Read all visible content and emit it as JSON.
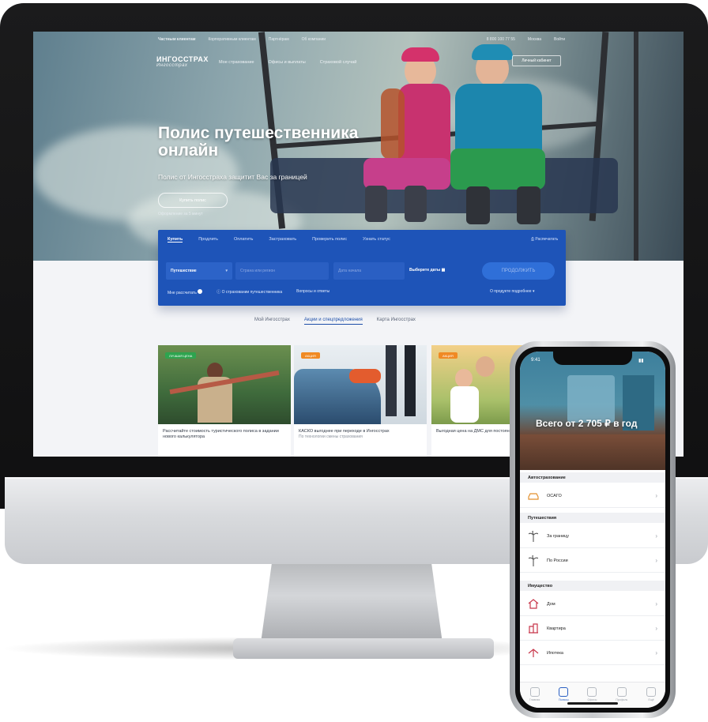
{
  "site": {
    "topnav": [
      "Частным клиентам",
      "Корпоративным клиентам",
      "Партнёрам",
      "Об компании"
    ],
    "topnav_right": [
      "8 800 100 77 55",
      "Москва",
      "Войти"
    ],
    "logo_text": "ИНГОССТРАХ",
    "logo_sub": "Ингосстрах",
    "mainnav": [
      "Мое страхование",
      "Офисы и выплаты",
      "Страховой случай"
    ],
    "login_label": "Личный кабинет",
    "hero": {
      "title": "Полис путешественника онлайн",
      "subtitle": "Полис от Ингосстраха защитит Вас за границей",
      "button": "Купить полис",
      "note": "Оформление за 5 минут"
    },
    "calc": {
      "tabs": [
        "Купить",
        "Продлить",
        "Оплатить",
        "Застраховать",
        "Проверить полис",
        "Узнать статус"
      ],
      "print_label": "Распечатать",
      "type_value": "Путешествие",
      "country_placeholder": "Страна или регион",
      "date_placeholder": "Дата начала",
      "dates_label": "Выберите даты",
      "submit_label": "ПРОДОЛЖИТЬ",
      "options": [
        "Мне рассчитать",
        "О страховании путешественника",
        "Вопросы и ответы"
      ],
      "more_label": "О продукте подробнее"
    },
    "page_tabs": [
      "Мой Ингосстрах",
      "Акции и спецпредложения",
      "Карта Ингосстрах"
    ],
    "cards": [
      {
        "tag": "ЛУЧШАЯ ЦЕНА",
        "text": "Рассчитайте стоимость туристического полиса в задании нового калькулятора"
      },
      {
        "tag": "АКЦИЯ",
        "text": "КАСКО выгоднее при переходе в Ингосстрах",
        "note": "По технологии смены страхования"
      },
      {
        "tag": "АКЦИЯ",
        "text": "Выгодная цена на ДМС для постоянных клиентов"
      }
    ]
  },
  "phone": {
    "status_time": "9:41",
    "hero_text": "Всего от 2 705 ₽ в год",
    "sections": [
      {
        "title": "Автострахование",
        "items": [
          {
            "label": "ОСАГО",
            "icon": "car-icon"
          }
        ]
      },
      {
        "title": "Путешествия",
        "items": [
          {
            "label": "За границу",
            "icon": "palm-icon"
          },
          {
            "label": "По России",
            "icon": "palm-icon"
          }
        ]
      },
      {
        "title": "Имущество",
        "items": [
          {
            "label": "Дом",
            "icon": "house-icon"
          },
          {
            "label": "Квартира",
            "icon": "apartment-icon"
          },
          {
            "label": "Ипотека",
            "icon": "mortgage-icon"
          }
        ]
      }
    ],
    "tabbar": [
      "Главная",
      "Полисы",
      "Офисы",
      "Профиль",
      "Ещё"
    ]
  },
  "colors": {
    "brand_blue": "#1e54b8",
    "accent_green": "#2ea44f",
    "accent_orange": "#f08a24"
  }
}
